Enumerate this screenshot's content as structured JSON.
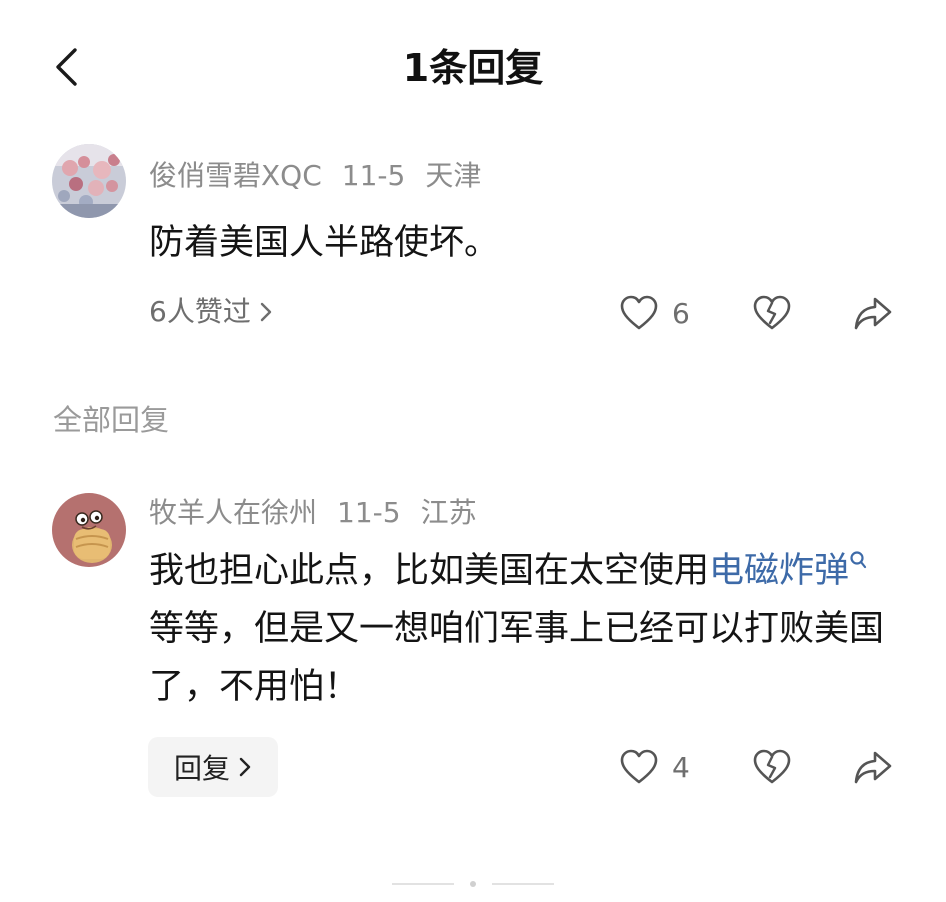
{
  "header": {
    "title": "1条回复"
  },
  "original_comment": {
    "username": "俊俏雪碧XQC",
    "date": "11-5",
    "location": "天津",
    "text": "防着美国人半路使坏。",
    "likes_summary": "6人赞过",
    "like_count": "6"
  },
  "section": {
    "label": "全部回复"
  },
  "reply": {
    "username": "牧羊人在徐州",
    "date": "11-5",
    "location": "江苏",
    "text_part1": "我也担心此点，比如美国在太空使用",
    "link_text": "电磁炸弹",
    "text_part2": "等等，但是又一想咱们军事上已经可以打败美国了，不用怕！",
    "reply_button_label": "回复",
    "like_count": "4"
  },
  "icons": {
    "back": "chevron-left-icon",
    "like": "heart-outline-icon",
    "dislike": "broken-heart-icon",
    "share": "share-arrow-icon",
    "search": "search-icon"
  },
  "colors": {
    "link": "#3d6aa8",
    "meta": "#8c8c8c",
    "text": "#141414"
  }
}
